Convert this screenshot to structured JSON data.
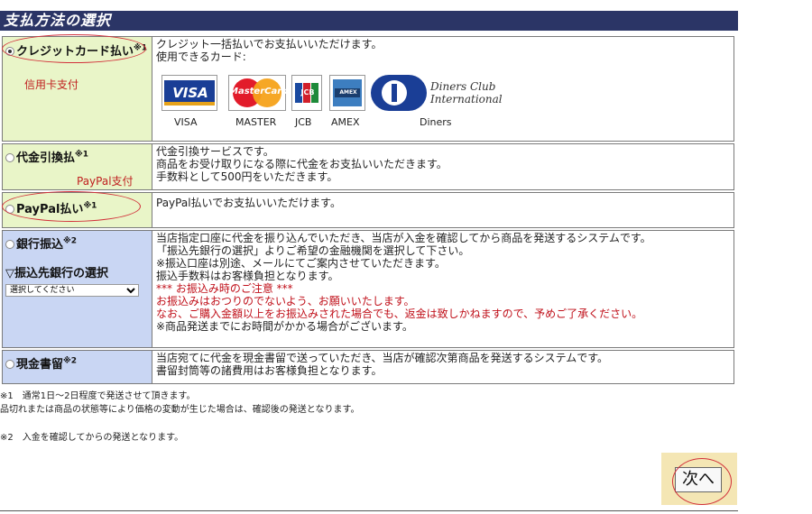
{
  "header": {
    "title": "支払方法の選択"
  },
  "methods": [
    {
      "label": "クレジットカード払い",
      "mark": "※1",
      "annotation": "信用卡支付",
      "desc": [
        "クレジット一括払いでお支払いいただけます。",
        "使用できるカード:"
      ],
      "cards": [
        {
          "name": "VISA",
          "logo": "VISA"
        },
        {
          "name": "MASTER",
          "logo": "MasterCard"
        },
        {
          "name": "JCB",
          "logo": "JCB"
        },
        {
          "name": "AMEX",
          "logo": "AMEX"
        },
        {
          "name": "Diners",
          "logo": "Diners Club International"
        }
      ]
    },
    {
      "label": "代金引換払",
      "mark": "※1",
      "annotation": "PayPal支付",
      "desc": [
        "代金引換サービスです。",
        "商品をお受け取りになる際に代金をお支払いいただきます。",
        "手数料として500円をいただきます。"
      ]
    },
    {
      "label": "PayPal払い",
      "mark": "※1",
      "desc": [
        "PayPal払いでお支払いいただけます。"
      ]
    },
    {
      "label": "銀行振込",
      "mark": "※2",
      "bank_select_label": "▽振込先銀行の選択",
      "bank_select_value": "選択してください",
      "desc": [
        "当店指定口座に代金を振り込んでいただき、当店が入金を確認してから商品を発送するシステムです。",
        "「振込先銀行の選択」よりご希望の金融機関を選択して下さい。",
        "※振込口座は別途、メールにてご案内させていただきます。",
        "振込手数料はお客様負担となります。"
      ],
      "warning": [
        "*** お振込み時のご注意 ***",
        "お振込みはおつりのでないよう、お願いいたします。",
        "なお、ご購入金額以上をお振込みされた場合でも、返金は致しかねますので、予めご了承ください。"
      ],
      "desc_tail": "※商品発送までにお時間がかかる場合がございます。"
    },
    {
      "label": "現金書留",
      "mark": "※2",
      "desc": [
        "当店宛てに代金を現金書留で送っていただき、当店が確認次第商品を発送するシステムです。",
        "書留封筒等の諸費用はお客様負担となります。"
      ]
    }
  ],
  "footnotes": [
    "※1　通常1日〜2日程度で発送させて頂きます。",
    "品切れまたは商品の状態等により価格の変動が生じた場合は、確認後の発送となります。",
    "※2　入金を確認してからの発送となります。"
  ],
  "next_button": "次へ",
  "colors": {
    "header_bg": "#2b3566",
    "green_cell": "#e9f5c8",
    "blue_cell": "#c9d6f3",
    "warning": "#c0101a",
    "annotation": "#d2303a"
  }
}
